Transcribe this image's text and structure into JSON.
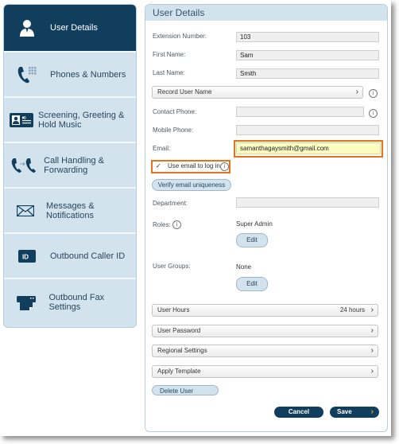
{
  "sidebar": {
    "items": [
      {
        "label": "User Details",
        "icon": "user-icon",
        "active": true
      },
      {
        "label": "Phones & Numbers",
        "icon": "phone-keypad-icon"
      },
      {
        "label": "Screening, Greeting & Hold Music",
        "icon": "id-card-icon"
      },
      {
        "label": "Call Handling & Forwarding",
        "icon": "call-forward-icon"
      },
      {
        "label": "Messages & Notifications",
        "icon": "envelope-icon"
      },
      {
        "label": "Outbound Caller ID",
        "icon": "caller-id-icon"
      },
      {
        "label": "Outbound Fax Settings",
        "icon": "fax-icon"
      }
    ]
  },
  "panel": {
    "title": "User Details",
    "extension_label": "Extension Number:",
    "extension_value": "103",
    "first_name_label": "First Name:",
    "first_name_value": "Sam",
    "last_name_label": "Last Name:",
    "last_name_value": "Smith",
    "record_user_name": "Record User Name",
    "contact_phone_label": "Contact Phone:",
    "contact_phone_value": "",
    "mobile_phone_label": "Mobile Phone:",
    "mobile_phone_value": "",
    "email_label": "Email:",
    "email_value": "samanthagaysmith@gmail.com",
    "use_email_login_label": "Use email to log in",
    "use_email_login_checked": true,
    "verify_email_button": "Verify email uniqueness",
    "department_label": "Department:",
    "department_value": "",
    "roles_label": "Roles:",
    "roles_value": "Super Admin",
    "edit_label": "Edit",
    "user_groups_label": "User Groups:",
    "user_groups_value": "None",
    "user_hours_label": "User Hours",
    "user_hours_value": "24 hours",
    "user_password_label": "User Password",
    "regional_settings_label": "Regional Settings",
    "apply_template_label": "Apply Template",
    "delete_user_button": "Delete User",
    "cancel_button": "Cancel",
    "save_button": "Save",
    "info_glyph": "i",
    "chevron_glyph": "›",
    "check_glyph": "✓"
  },
  "colors": {
    "primary_dark": "#123e5e",
    "sidebar_bg": "#d3e3ee",
    "highlight": "#e3741c",
    "email_bg": "#fdfdc2",
    "save_chevron": "#f0a030"
  }
}
